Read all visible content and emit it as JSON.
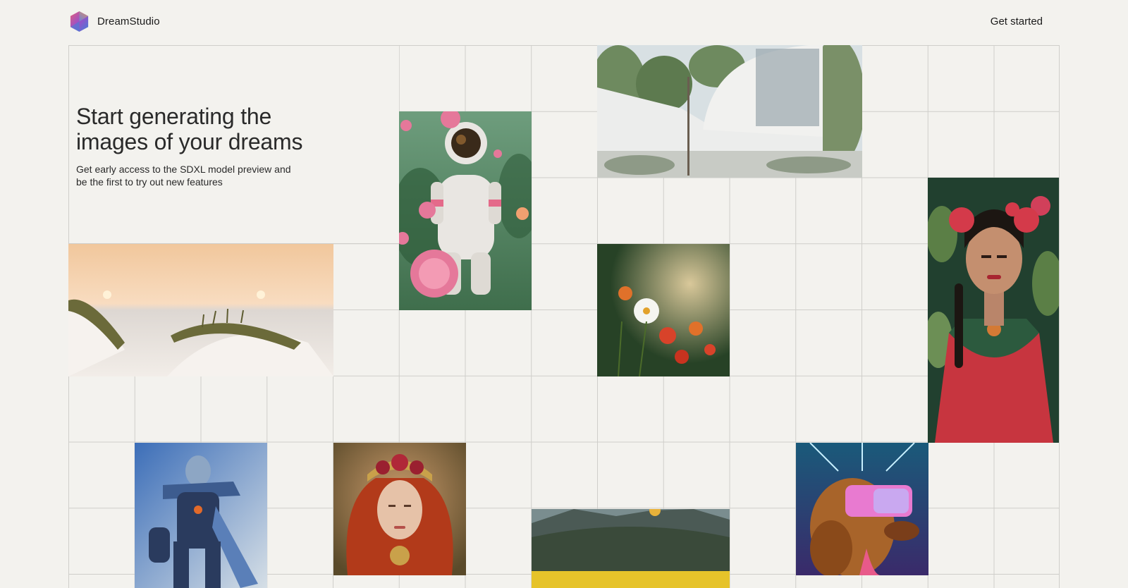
{
  "header": {
    "brand": "DreamStudio",
    "cta": "Get started"
  },
  "hero": {
    "title": "Start generating the images of your dreams",
    "subtitle": "Get early access to the SDXL model preview and be the first to try out new features"
  },
  "colors": {
    "background": "#f3f2ee",
    "grid_line": "#cfceca",
    "text": "#1a1a1a"
  },
  "gallery": [
    {
      "id": "astronaut",
      "icon": "astronaut-with-roses-image"
    },
    {
      "id": "modern-house",
      "icon": "futuristic-house-image"
    },
    {
      "id": "frida",
      "icon": "woman-portrait-flowers-image"
    },
    {
      "id": "beach-dunes",
      "icon": "sunset-dunes-image"
    },
    {
      "id": "daisy",
      "icon": "daisy-field-image"
    },
    {
      "id": "robot",
      "icon": "blue-robot-warrior-image"
    },
    {
      "id": "redhead",
      "icon": "redhead-crown-portrait-image"
    },
    {
      "id": "valley",
      "icon": "mountain-valley-image"
    },
    {
      "id": "vr-dog",
      "icon": "dog-vr-headset-image"
    }
  ]
}
